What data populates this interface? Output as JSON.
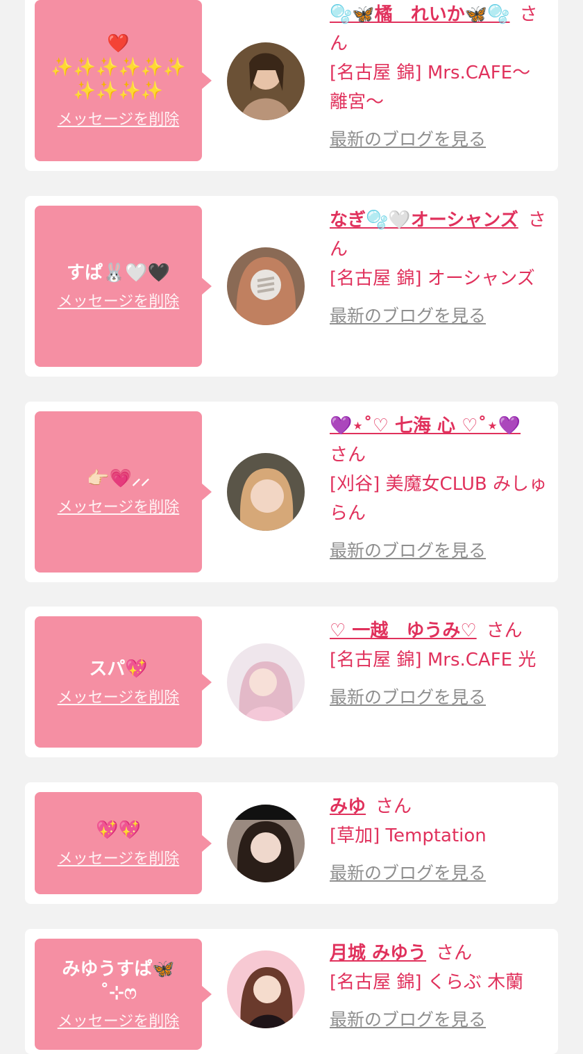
{
  "cards": [
    {
      "message": "❤️\n✨✨✨✨✨✨\n✨✨✨✨",
      "delete_label": "メッセージを削除",
      "name": "🫧🦋橘　れいか🦋🫧",
      "honorific": "さん",
      "shop": "[名古屋 錦] Mrs.CAFE〜離宮〜",
      "blog_label": "最新のブログを見る"
    },
    {
      "message": "すぱ🐰🤍🖤",
      "delete_label": "メッセージを削除",
      "name": "なぎ🫧🤍オーシャンズ",
      "honorific": "さん",
      "shop": "[名古屋 錦] オーシャンズ",
      "blog_label": "最新のブログを見る"
    },
    {
      "message": "👉🏻💗⸝⸝",
      "delete_label": "メッセージを削除",
      "name": "💜⋆˚♡ 七海 心 ♡˚⋆💜",
      "honorific": "さん",
      "shop": "[刈谷] 美魔女CLUB みしゅらん",
      "blog_label": "最新のブログを見る"
    },
    {
      "message": "スパ💖",
      "delete_label": "メッセージを削除",
      "name": "♡ 一越　ゆうみ♡",
      "honorific": "さん",
      "shop": "[名古屋 錦] Mrs.CAFE 光",
      "blog_label": "最新のブログを見る"
    },
    {
      "message": "💖💖",
      "delete_label": "メッセージを削除",
      "name": "みゆ",
      "honorific": "さん",
      "shop": "[草加] Temptation",
      "blog_label": "最新のブログを見る"
    },
    {
      "message": "みゆうすぱ🦋\n˚⊹ෆ",
      "delete_label": "メッセージを削除",
      "name": "月城 みゆう",
      "honorific": "さん",
      "shop": "[名古屋 錦] くらぶ 木蘭",
      "blog_label": "最新のブログを見る"
    }
  ],
  "colors": {
    "page_bg": "#f2f2f2",
    "card_bg": "#ffffff",
    "bubble": "#f58fa3",
    "accent": "#e0315c",
    "muted": "#8e8e8e"
  }
}
